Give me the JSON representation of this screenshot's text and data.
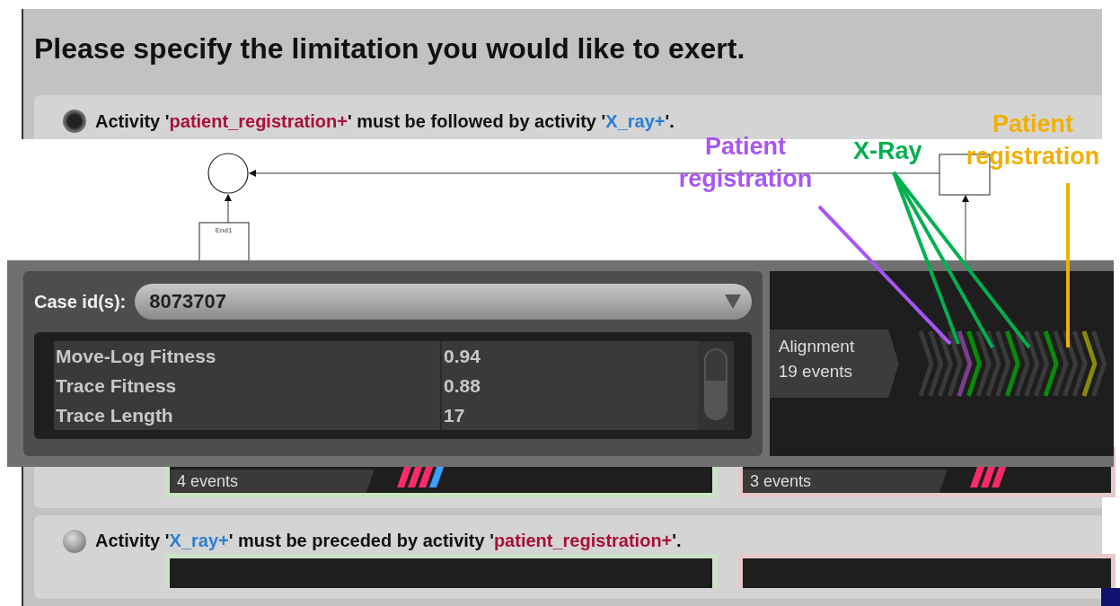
{
  "title": "Please specify the limitation you would like to exert.",
  "rules": [
    {
      "selected": true,
      "segments": [
        {
          "kind": "plain",
          "text": "Activity '"
        },
        {
          "kind": "activity",
          "text": "patient_registration+",
          "color": "#a8103a"
        },
        {
          "kind": "plain",
          "text": "' must be followed by activity '"
        },
        {
          "kind": "activity",
          "text": "X_ray+",
          "color": "#2a7fd0"
        },
        {
          "kind": "plain",
          "text": "'."
        }
      ],
      "examples": [
        {
          "kind": "example",
          "count": "4 events"
        },
        {
          "kind": "counter",
          "count": "3 events"
        }
      ]
    },
    {
      "selected": false,
      "segments": [
        {
          "kind": "plain",
          "text": "Activity '"
        },
        {
          "kind": "activity",
          "text": "X_ray+",
          "color": "#2a7fd0"
        },
        {
          "kind": "plain",
          "text": "' must be preceded by activity '"
        },
        {
          "kind": "activity",
          "text": "patient_registration+",
          "color": "#a8103a"
        },
        {
          "kind": "plain",
          "text": "'."
        }
      ],
      "examples": [
        {
          "kind": "example"
        },
        {
          "kind": "counter"
        }
      ]
    }
  ],
  "diagram": {
    "node_label": "End1"
  },
  "case_panel": {
    "label": "Case id(s):",
    "case_id": "8073707",
    "stats": [
      {
        "name": "Move-Log Fitness",
        "value": "0.94"
      },
      {
        "name": "Trace Fitness",
        "value": "0.88"
      },
      {
        "name": "Trace Length",
        "value": "17"
      }
    ],
    "alignment": {
      "title": "Alignment",
      "count": "19 events",
      "events": [
        {
          "color": "#3a3a3a"
        },
        {
          "color": "#3a3a3a"
        },
        {
          "color": "#3a3a3a"
        },
        {
          "color": "#3a3a3a"
        },
        {
          "color": "#7a3e8a"
        },
        {
          "color": "#0a8a0a"
        },
        {
          "color": "#3a3a3a"
        },
        {
          "color": "#3a3a3a"
        },
        {
          "color": "#3a3a3a"
        },
        {
          "color": "#0a8a0a"
        },
        {
          "color": "#3a3a3a"
        },
        {
          "color": "#3a3a3a"
        },
        {
          "color": "#3a3a3a"
        },
        {
          "color": "#0a8a0a"
        },
        {
          "color": "#3a3a3a"
        },
        {
          "color": "#3a3a3a"
        },
        {
          "color": "#3a3a3a"
        },
        {
          "color": "#8a8a0a"
        },
        {
          "color": "#3a3a3a"
        }
      ]
    }
  },
  "annotations": [
    {
      "text": "Patient registration",
      "color": "#a855f7"
    },
    {
      "text": "X-Ray",
      "color": "#00b050"
    },
    {
      "text": "Patient registration",
      "color": "#f0b000"
    }
  ]
}
